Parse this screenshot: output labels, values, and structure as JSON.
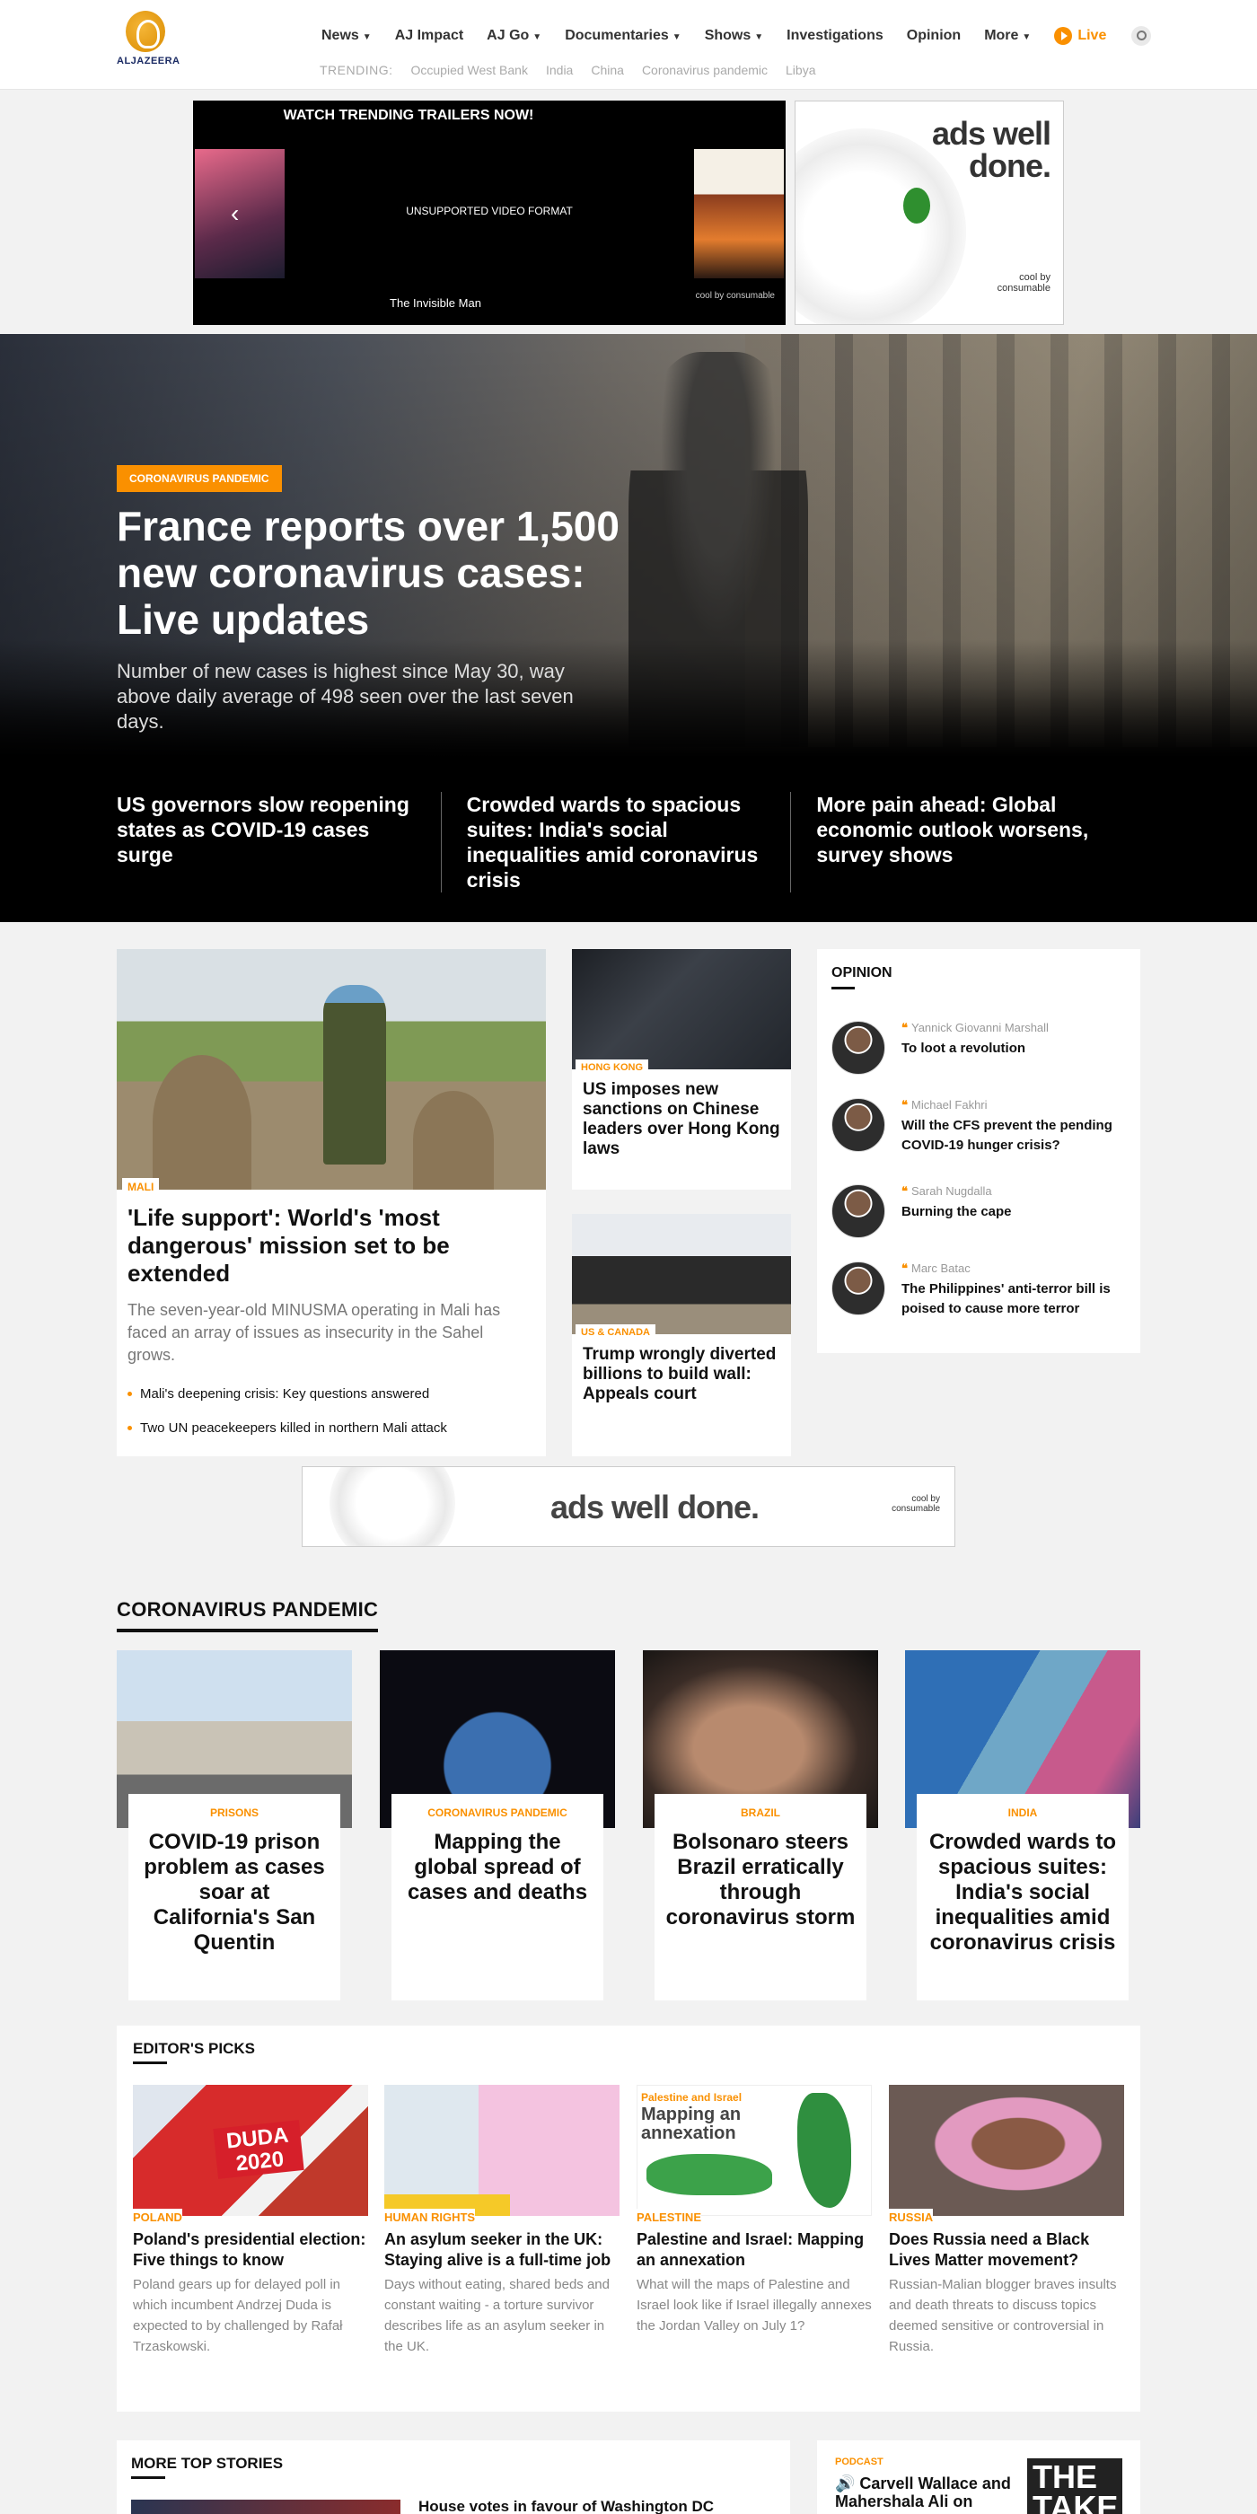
{
  "header": {
    "logo_text": "ALJAZEERA",
    "nav": [
      {
        "label": "News",
        "dropdown": true
      },
      {
        "label": "AJ Impact",
        "dropdown": false
      },
      {
        "label": "AJ Go",
        "dropdown": true
      },
      {
        "label": "Documentaries",
        "dropdown": true
      },
      {
        "label": "Shows",
        "dropdown": true
      },
      {
        "label": "Investigations",
        "dropdown": false
      },
      {
        "label": "Opinion",
        "dropdown": false
      },
      {
        "label": "More",
        "dropdown": true
      }
    ],
    "live_label": "Live",
    "trending_label": "TRENDING:",
    "trending": [
      "Occupied West Bank",
      "India",
      "China",
      "Coronavirus pandemic",
      "Libya"
    ]
  },
  "ads": {
    "video_title": "WATCH TRENDING TRAILERS NOW!",
    "unsupported": "UNSUPPORTED VIDEO FORMAT",
    "video_caption": "The Invisible Man",
    "consumable_small": "cool by consumable",
    "side_text": "ads well done.",
    "side_small": "cool by consumable",
    "banner_text": "ads well done.",
    "banner_small": "cool by consumable"
  },
  "hero": {
    "tag": "CORONAVIRUS PANDEMIC",
    "title": "France reports over 1,500 new coronavirus cases: Live updates",
    "dek": "Number of new cases is highest since May 30, way above daily average of 498 seen over the last seven days.",
    "subs": [
      "US governors slow reopening states as COVID-19 cases surge",
      "Crowded wards to spacious suites: India's social inequalities amid coronavirus crisis",
      "More pain ahead: Global economic outlook worsens, survey shows"
    ]
  },
  "feature": {
    "tag": "MALI",
    "title": "'Life support': World's 'most dangerous' mission set to be extended",
    "dek": "The seven-year-old MINUSMA operating in Mali has faced an array of issues as insecurity in the Sahel grows.",
    "related": [
      "Mali's deepening crisis: Key questions answered",
      "Two UN peacekeepers killed in northern Mali attack"
    ]
  },
  "mid_stories": [
    {
      "tag": "HONG KONG",
      "title": "US imposes new sanctions on Chinese leaders over Hong Kong laws"
    },
    {
      "tag": "US & CANADA",
      "title": "Trump wrongly diverted billions to build wall: Appeals court"
    }
  ],
  "opinion": {
    "heading": "OPINION",
    "items": [
      {
        "author": "Yannick Giovanni Marshall",
        "title": "To loot a revolution"
      },
      {
        "author": "Michael Fakhri",
        "title": "Will the CFS prevent the pending COVID-19 hunger crisis?"
      },
      {
        "author": "Sarah Nugdalla",
        "title": "Burning the cape"
      },
      {
        "author": "Marc Batac",
        "title": "The Philippines' anti-terror bill is poised to cause more terror"
      }
    ]
  },
  "coronavirus": {
    "heading": "CORONAVIRUS PANDEMIC",
    "cards": [
      {
        "tag": "PRISONS",
        "title": "COVID-19 prison problem as cases soar at California's San Quentin"
      },
      {
        "tag": "CORONAVIRUS PANDEMIC",
        "title": "Mapping the global spread of cases and deaths"
      },
      {
        "tag": "BRAZIL",
        "title": "Bolsonaro steers Brazil erratically through coronavirus storm"
      },
      {
        "tag": "INDIA",
        "title": "Crowded wards to spacious suites: India's social inequalities amid coronavirus crisis"
      }
    ]
  },
  "editors_picks": {
    "heading": "EDITOR'S PICKS",
    "items": [
      {
        "tag": "POLAND",
        "title": "Poland's presidential election: Five things to know",
        "desc": "Poland gears up for delayed poll in which incumbent Andrzej Duda is expected to by challenged by Rafał Trzaskowski.",
        "image_text": "DUDA 2020"
      },
      {
        "tag": "HUMAN RIGHTS",
        "title": "An asylum seeker in the UK: Staying alive is a full-time job",
        "desc": "Days without eating, shared beds and constant waiting - a torture survivor describes life as an asylum seeker in the UK."
      },
      {
        "tag": "PALESTINE",
        "title": "Palestine and Israel: Mapping an annexation",
        "desc": "What will the maps of Palestine and Israel look like if Israel illegally annexes the Jordan Valley on July 1?",
        "image_small": "Palestine and Israel",
        "image_big": "Mapping an annexation"
      },
      {
        "tag": "RUSSIA",
        "title": "Does Russia need a Black Lives Matter movement?",
        "desc": "Russian-Malian blogger braves insults and death threats to discuss topics deemed sensitive or controversial in Russia."
      }
    ]
  },
  "more_top": {
    "heading": "MORE TOP STORIES",
    "first_title": "House votes in favour of Washington DC"
  },
  "podcast": {
    "tag": "PODCAST",
    "title": "Carvell Wallace and Mahershala Ali on",
    "logo_text": "THE TAKE"
  },
  "colors": {
    "accent": "#fa9000",
    "brand_blue": "#1a2a63"
  }
}
